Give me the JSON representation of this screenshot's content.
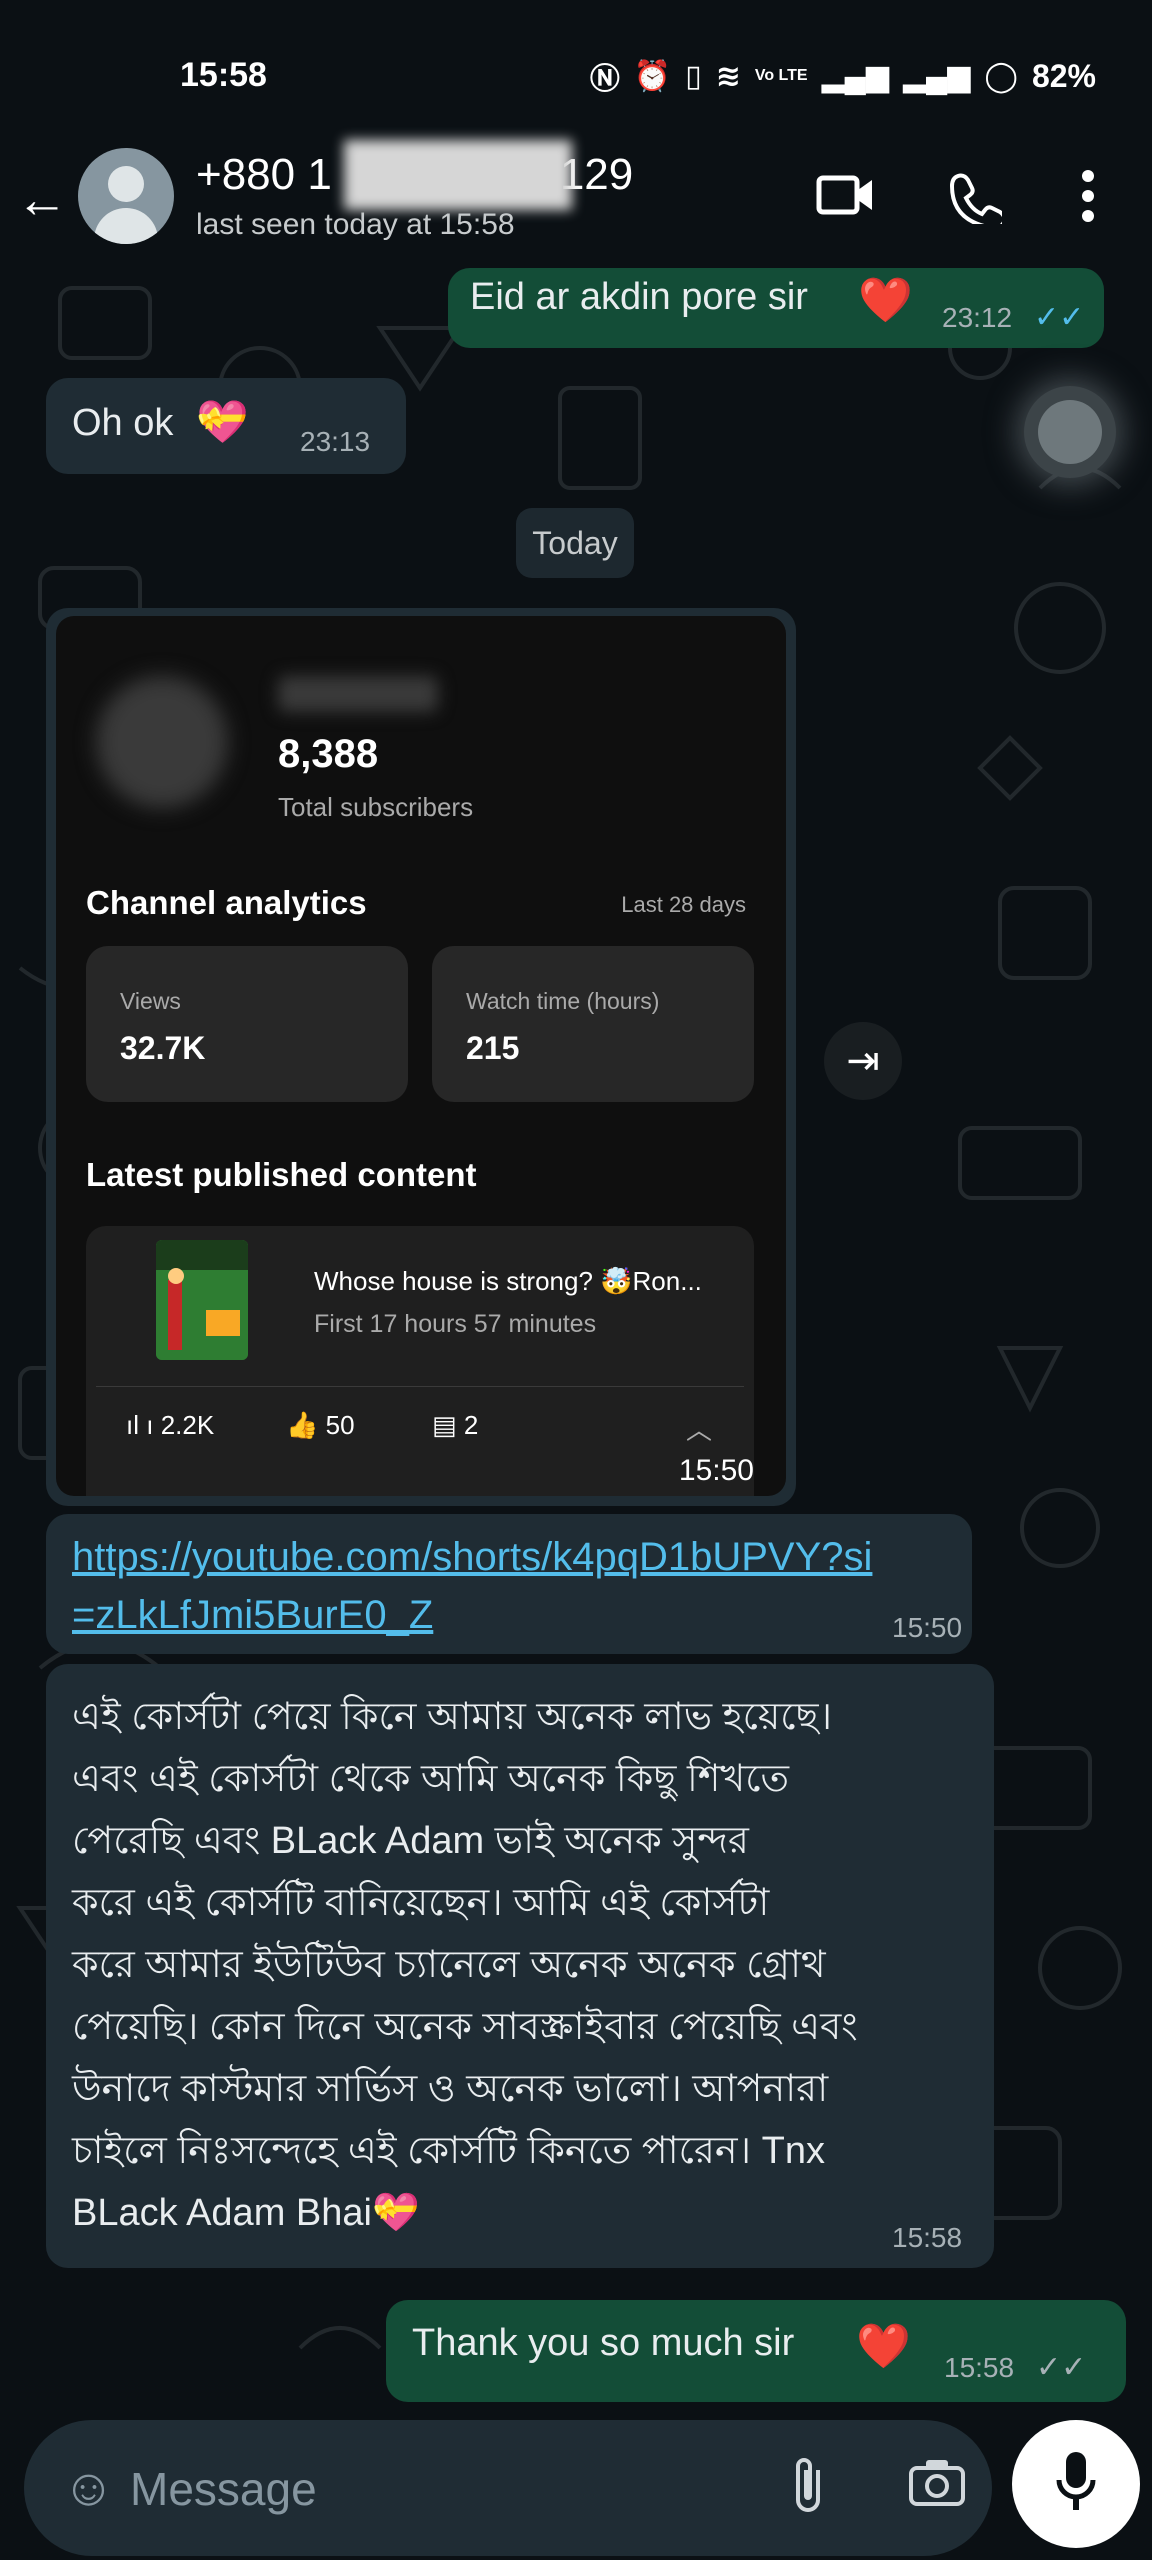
{
  "status_bar": {
    "time": "15:58",
    "net": "Vo LTE",
    "battery": "82%"
  },
  "header": {
    "contact_name_prefix": "+880 1",
    "contact_name_suffix": "129",
    "last_seen": "last seen today at 15:58"
  },
  "messages": {
    "m1": {
      "text": "Eid ar akdin pore sir",
      "time": "23:12"
    },
    "m2": {
      "text": "Oh ok",
      "time": "23:13"
    },
    "date_divider": "Today",
    "screenshot": {
      "subscribers": "8,388",
      "subscribers_label": "Total subscribers",
      "analytics_title": "Channel analytics",
      "analytics_range": "Last 28 days",
      "views_label": "Views",
      "views_value": "32.7K",
      "watch_label": "Watch time (hours)",
      "watch_value": "215",
      "latest_title": "Latest published content",
      "video_title": "Whose house is strong? 🤯Ron...",
      "video_sub": "First 17 hours 57 minutes",
      "video_views": "2.2K",
      "video_likes": "50",
      "video_comments": "2",
      "time": "15:50"
    },
    "link": {
      "line1": "https://youtube.com/shorts/k4pqD1bUPVY?si",
      "line2": "=zLkLfJmi5BurE0_Z",
      "time": "15:50"
    },
    "review": {
      "lines": [
        "এই কোর্সটা পেয়ে কিনে আমায় অনেক লাভ হয়েছে।",
        "এবং এই কোর্সটা থেকে আমি অনেক কিছু শিখতে",
        "পেরেছি এবং BLack Adam ভাই অনেক সুন্দর",
        "করে এই কোর্সটি বানিয়েছেন। আমি এই কোর্সটা",
        "করে আমার ইউটিউব চ্যানেলে অনেক অনেক গ্রোথ",
        "পেয়েছি। কোন দিনে অনেক সাবস্ক্রাইবার পেয়েছি এবং",
        "উনাদে কাস্টমার সার্ভিস ও অনেক ভালো। আপনারা",
        "চাইলে নিঃসন্দেহে এই কোর্সটি কিনতে পারেন। Tnx",
        "BLack Adam Bhai"
      ],
      "time": "15:58"
    },
    "m_last": {
      "text": "Thank you so much sir",
      "time": "15:58"
    }
  },
  "composer": {
    "placeholder": "Message"
  }
}
